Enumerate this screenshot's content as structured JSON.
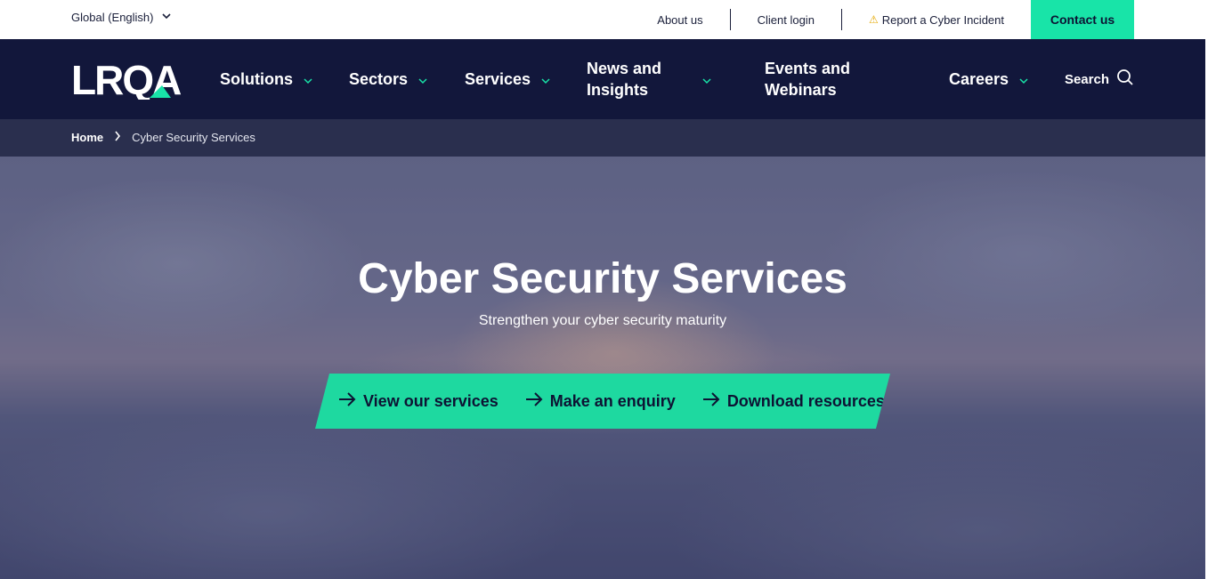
{
  "utility": {
    "region_label": "Global (English)",
    "about_label": "About us",
    "client_login_label": "Client login",
    "incident_label": "Report a Cyber Incident",
    "contact_label": "Contact us"
  },
  "nav": {
    "logo_text": "LRQA",
    "items": [
      {
        "label": "Solutions"
      },
      {
        "label": "Sectors"
      },
      {
        "label": "Services"
      },
      {
        "label": "News and Insights"
      },
      {
        "label": "Events and Webinars"
      },
      {
        "label": "Careers"
      }
    ],
    "search_label": "Search"
  },
  "breadcrumb": {
    "home": "Home",
    "current": "Cyber Security Services"
  },
  "hero": {
    "title": "Cyber Security Services",
    "subtitle": "Strengthen your cyber security maturity",
    "ctas": [
      {
        "label": "View our services"
      },
      {
        "label": "Make an enquiry"
      },
      {
        "label": "Download resources"
      }
    ]
  },
  "colors": {
    "accent": "#18e4a8",
    "nav_bg": "#12173b",
    "breadcrumb_bg": "#2a2f4e"
  }
}
